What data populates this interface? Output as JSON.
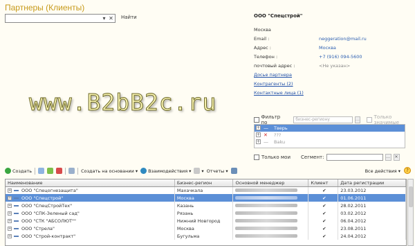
{
  "page": {
    "title": "Партнеры (Клиенты)",
    "watermark": "www.B2bB2c.ru"
  },
  "search": {
    "find_label": "Найти",
    "value": ""
  },
  "partner_card": {
    "name": "ООО \"Спецстрой\"",
    "city": "Москва",
    "email_label": "Email :",
    "email_value": "neggeration@mail.ru",
    "address_label": "Адрес :",
    "address_value": "Москва",
    "phone_label": "Телефон :",
    "phone_value": "+7 (916) 094-5600",
    "postal_label": "почтовый адрес :",
    "postal_value": "<Не указан>",
    "links": [
      "Досье партнера",
      "Контрагенты (2)",
      "Контактные лица (1)"
    ]
  },
  "filter": {
    "label": "Фильтр по",
    "placeholder": "бизнес-региону",
    "only_significant": "Только значимые",
    "regions": [
      {
        "name": "Тверь",
        "selected": true
      },
      {
        "name": "???",
        "selected": false
      },
      {
        "name": "Baku",
        "selected": false
      }
    ],
    "only_mine": "Только мои",
    "segment_label": "Сегмент:"
  },
  "toolbar": {
    "create": "Создать",
    "create_based_on": "Создать на основании",
    "interactions": "Взаимодействия",
    "reports": "Отчеты",
    "all_actions": "Все действия"
  },
  "table": {
    "columns": [
      "Наименование",
      "Бизнес-регион",
      "Основной менеджер",
      "Клиент",
      "Дата регистрации"
    ],
    "rows": [
      {
        "name": "ООО \"Спецогнезащита\"",
        "region": "Махачкала",
        "client": "✔",
        "date": "23.03.2012",
        "selected": false
      },
      {
        "name": "ООО \"Спецстрой\"",
        "region": "Москва",
        "client": "✔",
        "date": "01.06.2011",
        "selected": true
      },
      {
        "name": "ООО \"СпецСтройТех\"",
        "region": "Казань",
        "client": "✔",
        "date": "28.02.2011",
        "selected": false
      },
      {
        "name": "ООО \"СПК-Зеленый сад\"",
        "region": "Рязань",
        "client": "✔",
        "date": "03.02.2012",
        "selected": false
      },
      {
        "name": "ООО \"СТК \"АБСОЛЮТ\"\"",
        "region": "Нижний Новгород",
        "client": "✔",
        "date": "06.04.2012",
        "selected": false
      },
      {
        "name": "ООО \"Стрела\"",
        "region": "Москва",
        "client": "✔",
        "date": "23.08.2011",
        "selected": false
      },
      {
        "name": "ООО \"Строй-контракт\"",
        "region": "Бугульма",
        "client": "✔",
        "date": "24.04.2012",
        "selected": false
      }
    ]
  },
  "colors": {
    "title": "#c79a1a",
    "selection": "#5b8fd7",
    "link": "#1f4fa8"
  }
}
